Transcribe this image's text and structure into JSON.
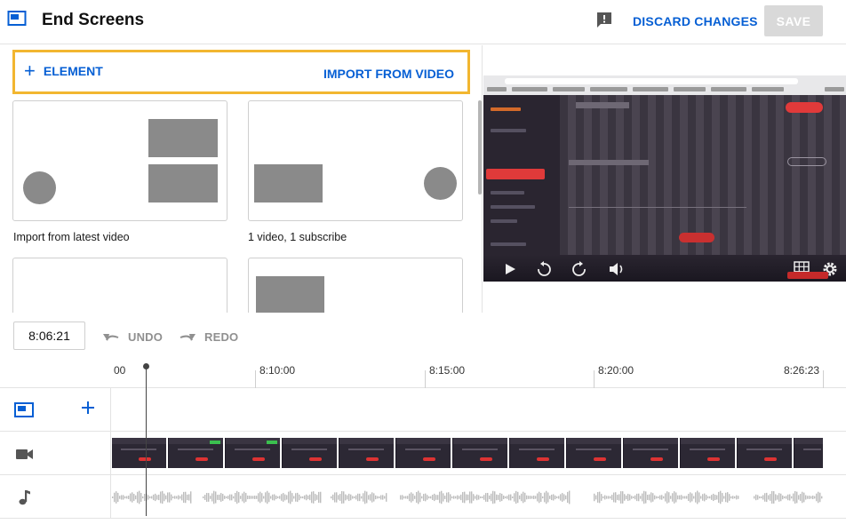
{
  "header": {
    "title": "End Screens",
    "discard_label": "DISCARD CHANGES",
    "save_label": "SAVE"
  },
  "actions": {
    "add_element_label": "ELEMENT",
    "import_label": "IMPORT FROM VIDEO"
  },
  "templates": [
    {
      "label": "Import from latest video"
    },
    {
      "label": "1 video, 1 subscribe"
    },
    {
      "label": ""
    },
    {
      "label": ""
    }
  ],
  "timeline": {
    "timecode": "8:06:21",
    "undo_label": "UNDO",
    "redo_label": "REDO",
    "ticks": [
      "00",
      "8:10:00",
      "8:15:00",
      "8:20:00",
      "8:26:23"
    ]
  },
  "colors": {
    "accent": "#065fd4",
    "highlight": "#f2b630",
    "save_disabled": "#d9d9d9"
  },
  "icons": {
    "header": "end-screen-icon",
    "feedback": "feedback-icon",
    "undo": "undo-icon",
    "redo": "redo-icon",
    "element_track": "element-track-icon",
    "video_track": "video-camera-icon",
    "audio_track": "music-note-icon"
  }
}
